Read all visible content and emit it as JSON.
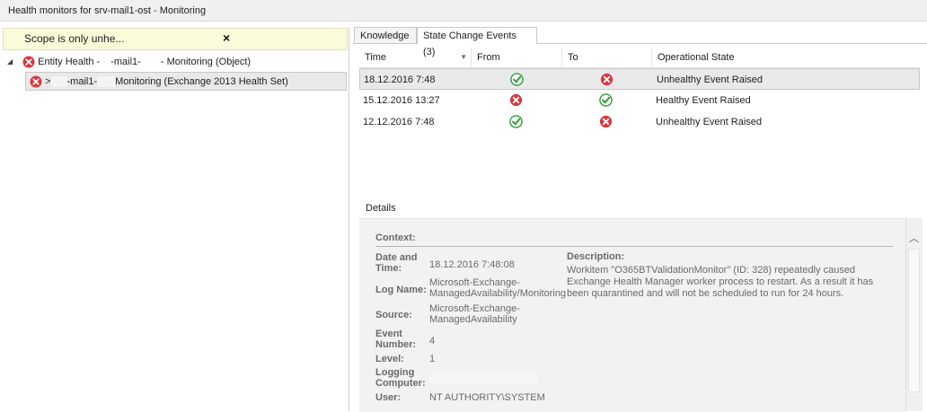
{
  "window": {
    "title": "Health monitors for srv-mail1-ost - Monitoring"
  },
  "scope": {
    "text": "Scope is only unhe...",
    "close_glyph": "×"
  },
  "tree": {
    "root": {
      "expander": "◢",
      "label_prefix": "Entity Health -",
      "label_mid": "-mail1-",
      "label_suffix": "- Monitoring (Object)"
    },
    "child": {
      "label_prefix": ">",
      "label_mid": "-mail1-",
      "label_suffix": "Monitoring (Exchange 2013 Health Set)"
    }
  },
  "tabs": [
    {
      "label": "Knowledge"
    },
    {
      "label": "State Change Events (3)"
    }
  ],
  "grid": {
    "columns": [
      "Time",
      "From",
      "To",
      "Operational State"
    ],
    "sort_glyph": "▼",
    "rows": [
      {
        "time": "18.12.2016 7:48",
        "from": "ok",
        "to": "error",
        "state": "Unhealthy Event Raised"
      },
      {
        "time": "15.12.2016 13:27",
        "from": "error",
        "to": "ok",
        "state": "Healthy Event Raised"
      },
      {
        "time": "12.12.2016 7:48",
        "from": "ok",
        "to": "error",
        "state": "Unhealthy Event Raised"
      }
    ]
  },
  "details": {
    "label": "Details",
    "context_label": "Context:",
    "fields": {
      "date_label": "Date and Time:",
      "date_value": "18.12.2016 7:48:08",
      "log_label": "Log Name:",
      "log_value": "Microsoft-Exchange-ManagedAvailability/Monitoring",
      "source_label": "Source:",
      "source_value": "Microsoft-Exchange-ManagedAvailability",
      "event_label": "Event Number:",
      "event_value": "4",
      "level_label": "Level:",
      "level_value": "1",
      "computer_label": "Logging Computer:",
      "user_label": "User:",
      "user_value": "NT AUTHORITY\\SYSTEM"
    },
    "description_label": "Description:",
    "description_text": "Workitem \"O365BTValidationMonitor\" (ID: 328) repeatedly caused Exchange Health Manager worker process to restart. As a result it has been quarantined and will not be scheduled to run for 24 hours.",
    "scroll_up_glyph": "︿"
  },
  "colors": {
    "error": "#d9363e",
    "ok": "#2f9e3a",
    "selection": "#e9e9e9",
    "scope_bg": "#fbfbd9"
  }
}
